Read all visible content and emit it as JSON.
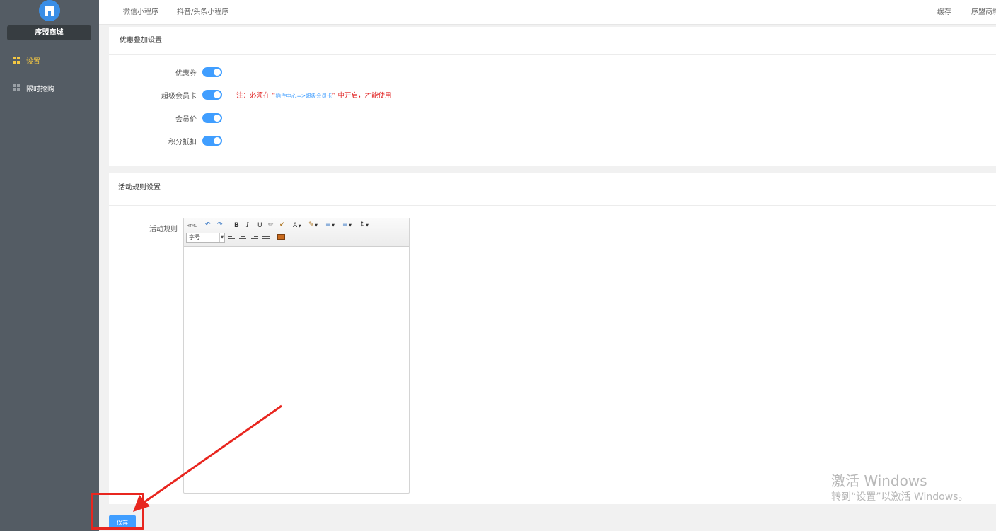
{
  "sidebar": {
    "store_name": "序盟商城",
    "items": [
      {
        "label": "设置",
        "icon": "grid-icon"
      },
      {
        "label": "限时抢购",
        "icon": "grid-icon"
      }
    ]
  },
  "topnav": {
    "tabs": [
      "微信小程序",
      "抖音/头条小程序"
    ],
    "cache": "缓存",
    "store": "序盟商城"
  },
  "discount_section": {
    "title": "优惠叠加设置",
    "rows": [
      {
        "label": "优惠券",
        "enabled": true
      },
      {
        "label": "超级会员卡",
        "enabled": true
      },
      {
        "label": "会员价",
        "enabled": true
      },
      {
        "label": "积分抵扣",
        "enabled": true
      }
    ],
    "note_prefix": "注：必须在 “",
    "note_link": "插件中心=>超级会员卡",
    "note_suffix": "” 中开启，才能使用"
  },
  "rules_section": {
    "title": "活动规则设置",
    "label": "活动规则",
    "toolbar": {
      "html": "HTML",
      "bold": "B",
      "italic": "I",
      "underline": "U",
      "font_color": "A",
      "font_size_select": "字号"
    }
  },
  "save_label": "保存",
  "watermark": {
    "line1": "激活 Windows",
    "line2": "转到“设置”以激活 Windows。"
  },
  "colors": {
    "sidebar_bg": "#545c64",
    "accent": "#409eff",
    "active_menu": "#f5c842",
    "warning": "#e02020",
    "annotation": "#e8261f"
  }
}
